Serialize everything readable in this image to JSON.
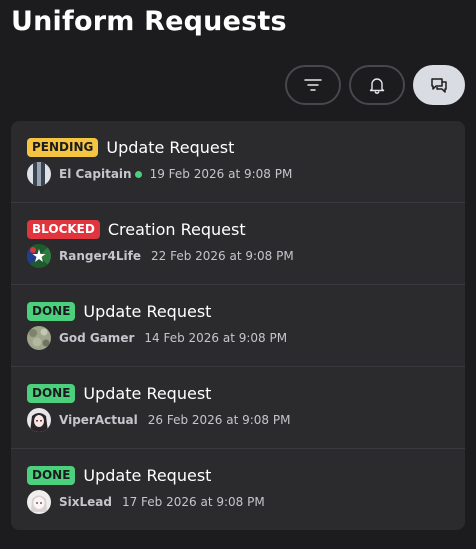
{
  "header": {
    "title": "Uniform Requests"
  },
  "toolbar": {
    "buttons": [
      {
        "icon": "filter-icon",
        "active": false
      },
      {
        "icon": "bell-icon",
        "active": false
      },
      {
        "icon": "chat-icon",
        "active": true
      }
    ]
  },
  "colors": {
    "pending": "#f5c542",
    "blocked": "#e0353c",
    "done": "#4cd07d",
    "online": "#4cd07d"
  },
  "requests": [
    {
      "status": "PENDING",
      "title": "Update Request",
      "user": "El Capitain",
      "online": true,
      "date": "19 Feb 2026 at 9:08 PM"
    },
    {
      "status": "BLOCKED",
      "title": "Creation Request",
      "user": "Ranger4Life",
      "online": false,
      "date": "22 Feb 2026 at 9:08 PM"
    },
    {
      "status": "DONE",
      "title": "Update Request",
      "user": "God Gamer",
      "online": false,
      "date": "14 Feb 2026 at 9:08 PM"
    },
    {
      "status": "DONE",
      "title": "Update Request",
      "user": "ViperActual",
      "online": false,
      "date": "26 Feb 2026 at 9:08 PM"
    },
    {
      "status": "DONE",
      "title": "Update Request",
      "user": "SixLead",
      "online": false,
      "date": "17 Feb 2026 at 9:08 PM"
    }
  ]
}
